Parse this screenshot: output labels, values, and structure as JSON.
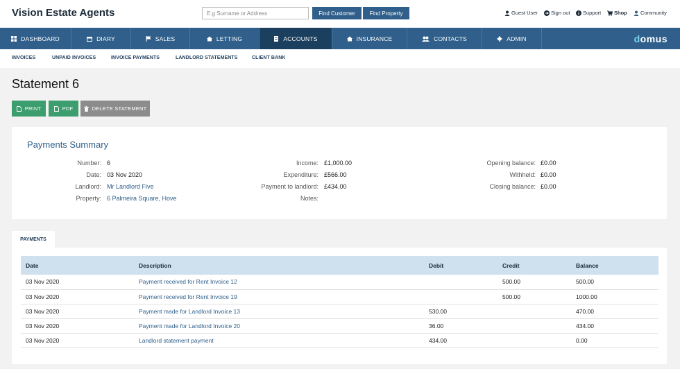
{
  "header": {
    "brand": "Vision Estate Agents",
    "search_placeholder": "E.g Surname or Address",
    "find_customer": "Find Customer",
    "find_property": "Find Property",
    "utils": {
      "guest": "Guest User",
      "signout": "Sign out",
      "support": "Support",
      "shop": "Shop",
      "community": "Community"
    }
  },
  "nav": {
    "items": [
      "DASHBOARD",
      "DIARY",
      "SALES",
      "LETTING",
      "ACCOUNTS",
      "INSURANCE",
      "CONTACTS",
      "ADMIN"
    ],
    "active": "ACCOUNTS",
    "logo_first": "d",
    "logo_rest": "omus"
  },
  "subnav": [
    "INVOICES",
    "UNPAID INVOICES",
    "INVOICE PAYMENTS",
    "LANDLORD STATEMENTS",
    "CLIENT BANK"
  ],
  "page": {
    "title": "Statement 6",
    "print": "PRINT",
    "pdf": "PDF",
    "delete": "DELETE STATEMENT"
  },
  "summary": {
    "title": "Payments Summary",
    "col1": [
      {
        "label": "Number:",
        "value": "6"
      },
      {
        "label": "Date:",
        "value": "03 Nov 2020"
      },
      {
        "label": "Landlord:",
        "value": "Mr Landlord Five"
      },
      {
        "label": "Property:",
        "value": "6 Palmeira Square, Hove"
      }
    ],
    "col2": [
      {
        "label": "Income:",
        "value": "£1,000.00"
      },
      {
        "label": "Expenditure:",
        "value": "£566.00"
      },
      {
        "label": "Payment to landlord:",
        "value": "£434.00"
      },
      {
        "label": "Notes:",
        "value": ""
      }
    ],
    "col3": [
      {
        "label": "Opening balance:",
        "value": "£0.00"
      },
      {
        "label": "Withheld:",
        "value": "£0.00"
      },
      {
        "label": "Closing balance:",
        "value": "£0.00"
      }
    ]
  },
  "payments": {
    "tab": "PAYMENTS",
    "headers": {
      "date": "Date",
      "description": "Description",
      "debit": "Debit",
      "credit": "Credit",
      "balance": "Balance"
    },
    "rows": [
      {
        "date": "03 Nov 2020",
        "description": "Payment received for Rent Invoice 12",
        "debit": "",
        "credit": "500.00",
        "balance": "500.00"
      },
      {
        "date": "03 Nov 2020",
        "description": "Payment received for Rent Invoice 19",
        "debit": "",
        "credit": "500.00",
        "balance": "1000.00"
      },
      {
        "date": "03 Nov 2020",
        "description": "Payment made for Landlord Invoice 13",
        "debit": "530.00",
        "credit": "",
        "balance": "470.00"
      },
      {
        "date": "03 Nov 2020",
        "description": "Payment made for Landlord Invoice 20",
        "debit": "36.00",
        "credit": "",
        "balance": "434.00"
      },
      {
        "date": "03 Nov 2020",
        "description": "Landlord statement payment",
        "debit": "434.00",
        "credit": "",
        "balance": "0.00"
      }
    ]
  },
  "colors": {
    "nav": "#2f5f8a",
    "nav_active": "#1b3f5e",
    "green_button": "#3c9e6f",
    "grey_button": "#8c8c8c",
    "table_header": "#cfe0ee"
  }
}
